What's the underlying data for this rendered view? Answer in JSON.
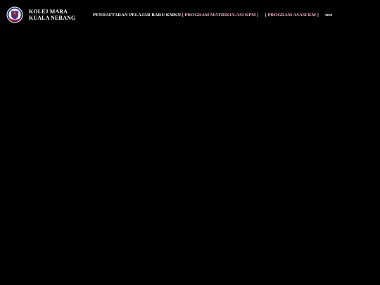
{
  "brand": {
    "line1": "KOLEJ MARA",
    "line2": "KUALA NERANG",
    "logo_icon": "kmkn-crest-icon"
  },
  "nav": {
    "item1": "PENDAFTARAN PELAJAR BARU KMKN",
    "item2": "[ PROGRAM MATRIKULASI KPM ]",
    "item3": "[ PROGRAM ASASI KM ]",
    "item4": "test"
  },
  "colors": {
    "background": "#000000",
    "text_primary": "#ffffff",
    "text_accent": "#f2b8c9"
  }
}
